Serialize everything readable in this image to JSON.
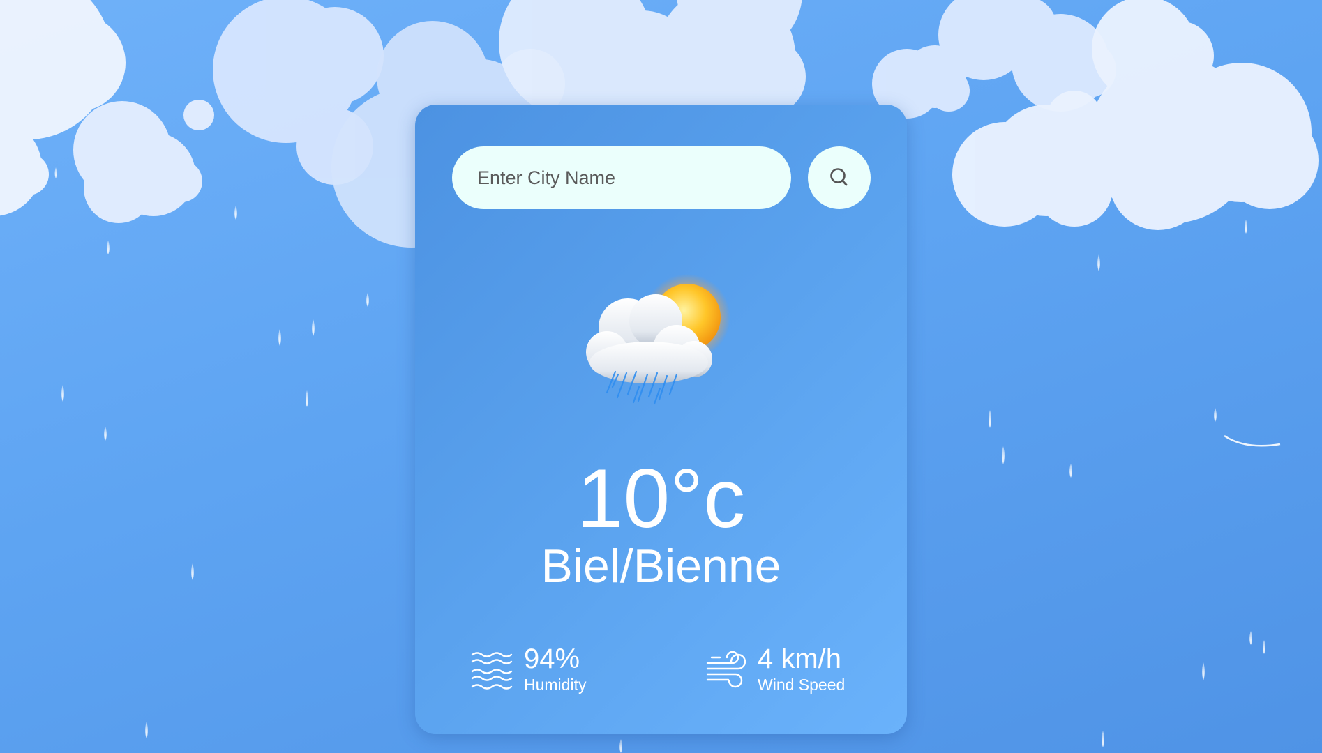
{
  "search": {
    "placeholder": "Enter City Name",
    "value": ""
  },
  "weather": {
    "condition_icon": "sun-behind-rain-cloud-icon",
    "temperature": "10°c",
    "city": "Biel/Bienne"
  },
  "details": {
    "humidity": {
      "value": "94%",
      "label": "Humidity",
      "icon": "humidity-waves-icon"
    },
    "wind": {
      "value": "4 km/h",
      "label": "Wind Speed",
      "icon": "wind-icon"
    }
  },
  "colors": {
    "background": "#5ea4f2",
    "card": "#5aa2ee",
    "input": "#ebfffc",
    "text": "#ffffff"
  }
}
